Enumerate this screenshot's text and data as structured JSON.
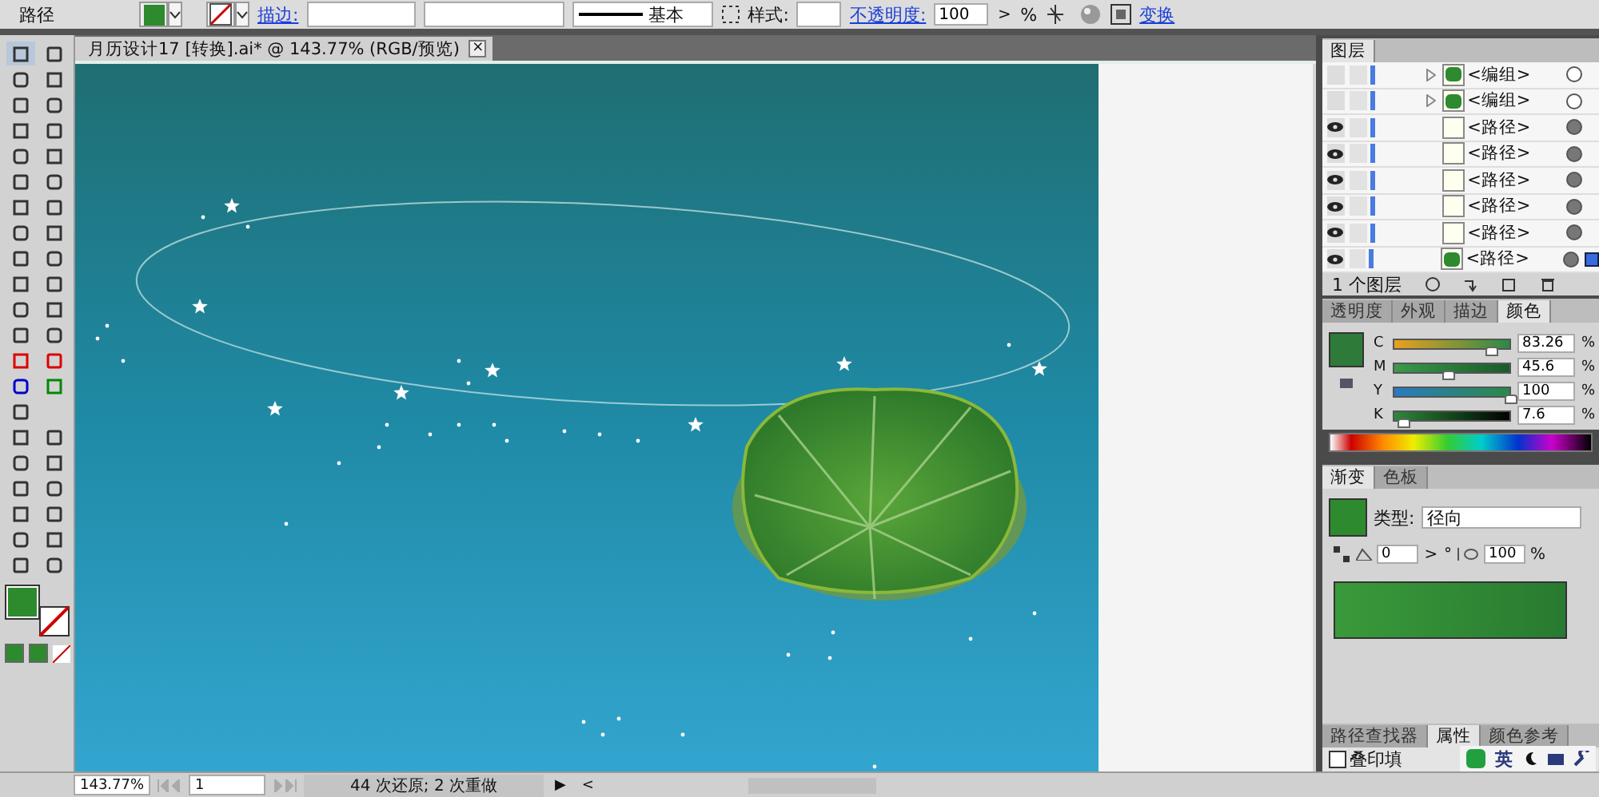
{
  "control_bar": {
    "object_type": "路径",
    "stroke_label": "描边:",
    "stroke_profile": "基本",
    "style_label": "样式:",
    "opacity_label": "不透明度:",
    "opacity_value": "100",
    "opacity_unit": "%",
    "opacity_arrow": ">",
    "transform_link": "变换"
  },
  "document_tab": {
    "title": "月历设计17  [转换].ai* @ 143.77% (RGB/预览)",
    "close": "×"
  },
  "layers_panel": {
    "title": "图层",
    "rows": [
      {
        "name": "<编组>",
        "visible": false,
        "expandable": true,
        "filled_thumbnail": true,
        "targeted": false,
        "selected": false
      },
      {
        "name": "<编组>",
        "visible": false,
        "expandable": true,
        "filled_thumbnail": true,
        "targeted": false,
        "selected": false
      },
      {
        "name": "<路径>",
        "visible": true,
        "expandable": false,
        "filled_thumbnail": false,
        "targeted": true,
        "selected": false
      },
      {
        "name": "<路径>",
        "visible": true,
        "expandable": false,
        "filled_thumbnail": false,
        "targeted": true,
        "selected": false
      },
      {
        "name": "<路径>",
        "visible": true,
        "expandable": false,
        "filled_thumbnail": false,
        "targeted": true,
        "selected": false
      },
      {
        "name": "<路径>",
        "visible": true,
        "expandable": false,
        "filled_thumbnail": false,
        "targeted": true,
        "selected": false
      },
      {
        "name": "<路径>",
        "visible": true,
        "expandable": false,
        "filled_thumbnail": false,
        "targeted": true,
        "selected": false
      },
      {
        "name": "<路径>",
        "visible": true,
        "expandable": false,
        "filled_thumbnail": true,
        "targeted": true,
        "selected": true
      }
    ],
    "count": "1 个图层"
  },
  "panel_tabs": [
    {
      "label": "透明度",
      "selected": false
    },
    {
      "label": "外观",
      "selected": false
    },
    {
      "label": "描边",
      "selected": false
    },
    {
      "label": "颜色",
      "selected": true
    }
  ],
  "color_panel": {
    "channels": [
      {
        "name": "C",
        "level": 0.8326,
        "value": "83.26",
        "unit": "%"
      },
      {
        "name": "M",
        "level": 0.456,
        "value": "45.6",
        "unit": "%"
      },
      {
        "name": "Y",
        "level": 1.0,
        "value": "100",
        "unit": "%"
      },
      {
        "name": "K",
        "level": 0.076,
        "value": "7.6",
        "unit": "%"
      }
    ]
  },
  "gradient_tabs": [
    {
      "label": "渐变",
      "selected": true
    },
    {
      "label": "色板",
      "selected": false
    }
  ],
  "gradient_panel": {
    "type_label": "类型:",
    "type_value": "径向",
    "angle": "0",
    "angle_arrow": ">",
    "degree": "°",
    "ratio": "100",
    "ratio_unit": "%"
  },
  "bottom_tabs": [
    {
      "label": "路径查找器",
      "selected": false
    },
    {
      "label": "属性",
      "selected": true
    },
    {
      "label": "颜色参考",
      "selected": false
    }
  ],
  "overprint": {
    "label": "叠印填",
    "checked": false
  },
  "ime_bar": {
    "language": "英"
  },
  "status_bar": {
    "zoom": "143.77%",
    "artboard": "1",
    "message": "44 次还原; 2 次重做",
    "play": "▶",
    "scroll_left": "<"
  }
}
